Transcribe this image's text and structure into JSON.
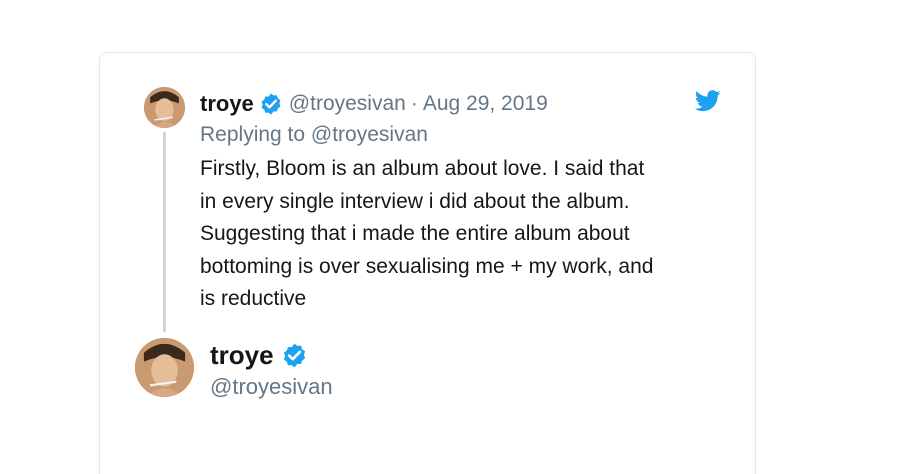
{
  "reply_tweet": {
    "display_name": "troye",
    "handle": "@troyesivan",
    "separator": "·",
    "date": "Aug 29, 2019",
    "replying_to": "Replying to @troyesivan",
    "text_lines": [
      "Firstly, Bloom is an album about love. I said that",
      "in every single interview i did about the album.",
      "Suggesting that i made the entire album about",
      "bottoming is over sexualising me + my work, and",
      "is reductive"
    ]
  },
  "author": {
    "display_name": "troye",
    "handle": "@troyesivan"
  },
  "icons": {
    "verified": "verified-badge-icon",
    "platform": "twitter-bird-icon"
  },
  "colors": {
    "twitter_blue": "#1da1f2",
    "text_primary": "#14171a",
    "text_secondary": "#657786",
    "thread_line": "#ccd6dd",
    "card_border": "#e1e8ed"
  }
}
